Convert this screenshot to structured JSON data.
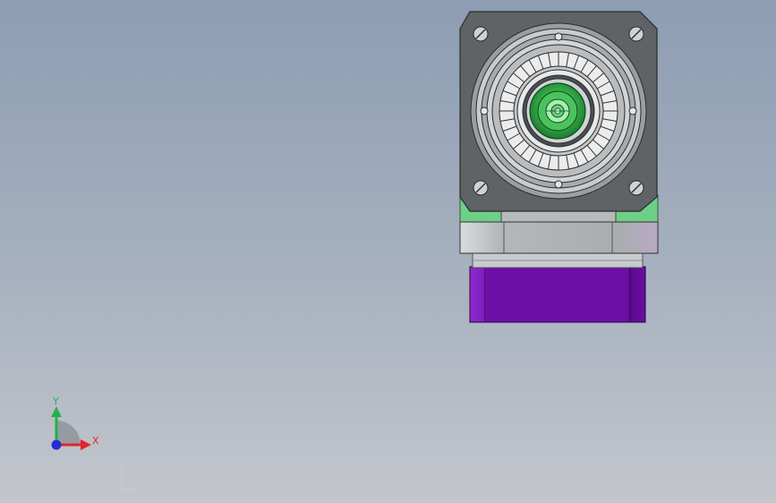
{
  "viewport": {
    "background_top": "#8d9db3",
    "background_bottom": "#c3c6cc"
  },
  "model": {
    "icon": "gearbox-model",
    "colors": {
      "flange": "#5f6366",
      "flange_dark": "#3f4244",
      "housing_green": "#6ecf86",
      "collar_silver": "#bfc3c6",
      "shaft_green": "#39b24a",
      "motor_purple": "#6b0fa6",
      "motor_purple_light": "#8e2bd0"
    }
  },
  "triad": {
    "x_label": "X",
    "y_label": "Y",
    "x_color": "#e0262b",
    "y_color": "#22b14c",
    "z_color": "#1f2fd0"
  }
}
